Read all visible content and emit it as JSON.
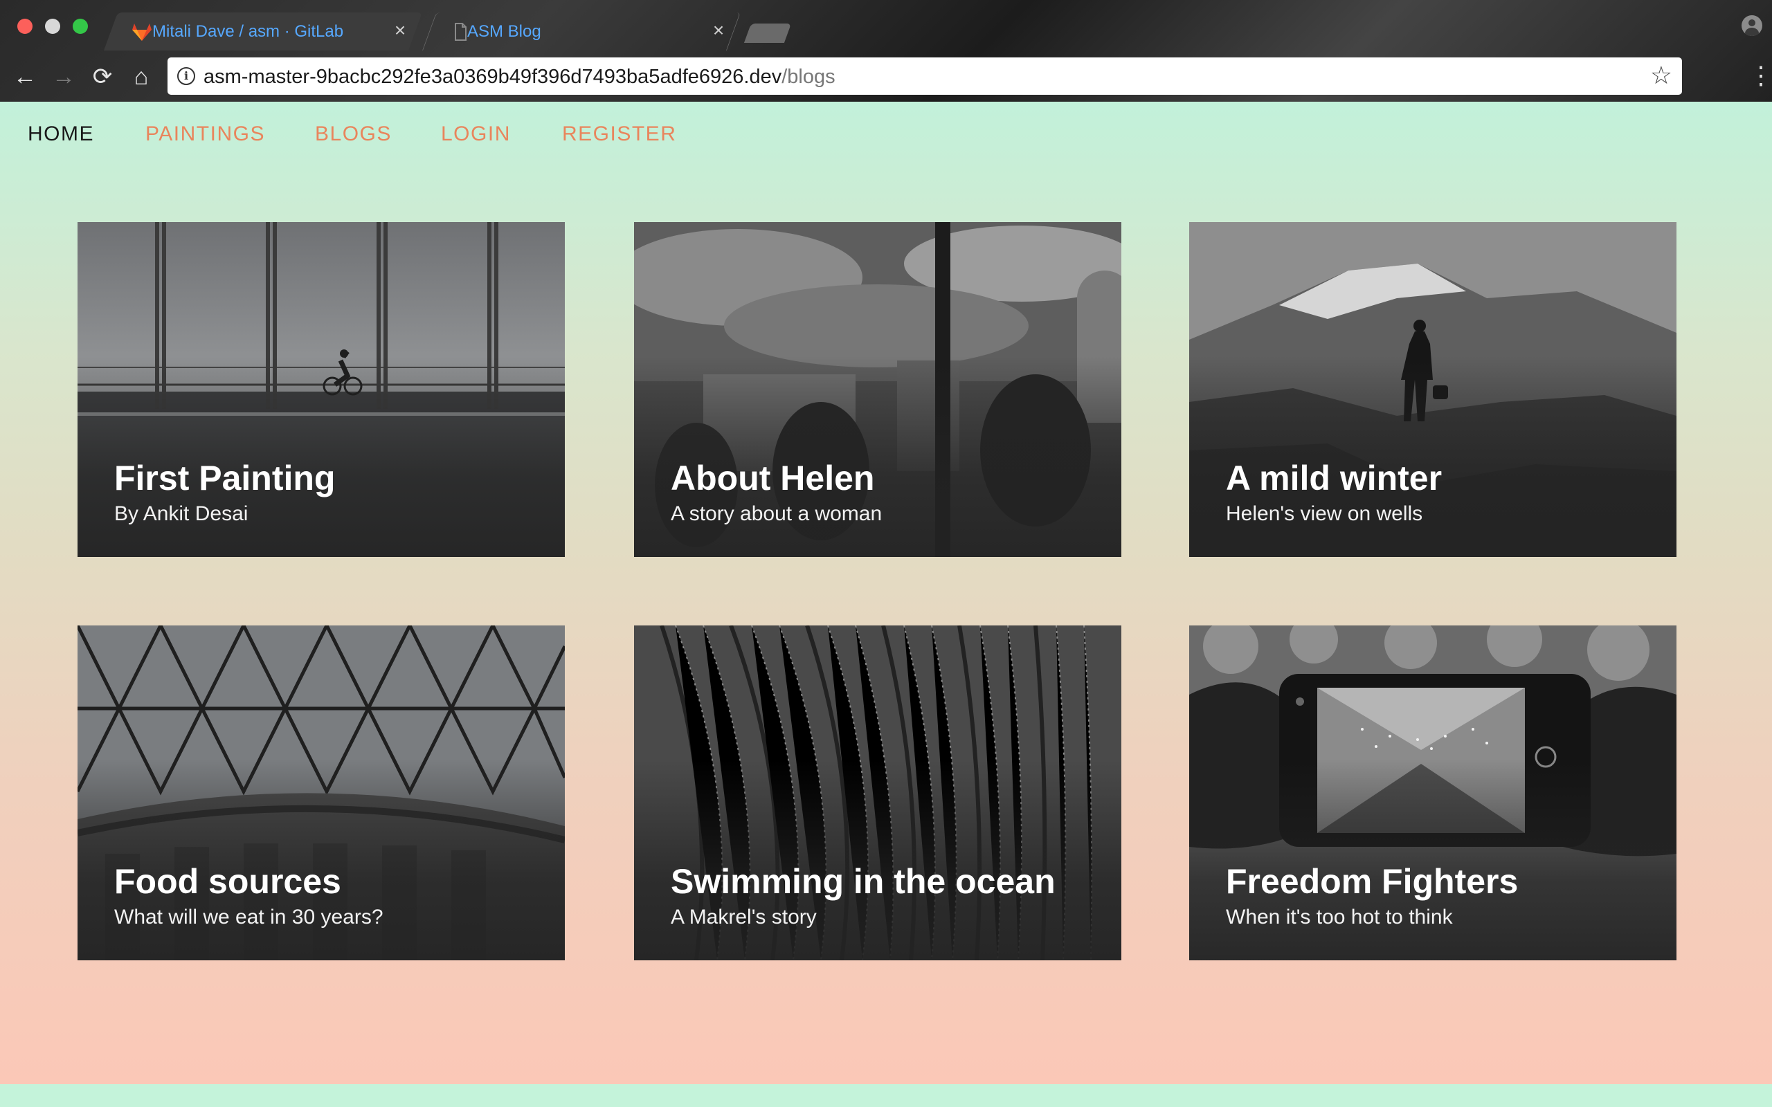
{
  "browser": {
    "tabs": [
      {
        "title": "Mitali Dave / asm · GitLab",
        "icon": "gitlab-icon",
        "active": true
      },
      {
        "title": "ASM Blog",
        "icon": "document-icon",
        "active": false
      }
    ],
    "close_glyph": "×",
    "url_host": "asm-master-9bacbc292fe3a0369b49f396d7493ba5adfe6926.dev",
    "url_path": "/blogs",
    "toolbar": {
      "back_glyph": "←",
      "forward_glyph": "→",
      "reload_glyph": "⟳",
      "home_glyph": "⌂",
      "info_glyph": "i",
      "star_glyph": "☆",
      "menu_glyph": "⋮"
    }
  },
  "nav": {
    "items": [
      {
        "label": "HOME",
        "active": true
      },
      {
        "label": "PAINTINGS",
        "active": false
      },
      {
        "label": "BLOGS",
        "active": false
      },
      {
        "label": "LOGIN",
        "active": false
      },
      {
        "label": "REGISTER",
        "active": false
      }
    ]
  },
  "colors": {
    "nav_accent": "#e9855c",
    "nav_active": "#1a1a1a",
    "gradient_top": "#c2f1da",
    "gradient_bottom": "#fbc8b7"
  },
  "cards": [
    {
      "title": "First Painting",
      "subtitle": "By Ankit Desai",
      "image": "bridge-cyclist-image"
    },
    {
      "title": "About Helen",
      "subtitle": "A story about a woman",
      "image": "city-clouds-silhouettes-image"
    },
    {
      "title": "A mild winter",
      "subtitle": "Helen's view on wells",
      "image": "mountain-hiker-image"
    },
    {
      "title": "Food sources",
      "subtitle": "What will we eat in 30 years?",
      "image": "glass-dome-roof-image"
    },
    {
      "title": "Swimming in the ocean",
      "subtitle": "A Makrel's story",
      "image": "library-bookshelves-image"
    },
    {
      "title": "Freedom Fighters",
      "subtitle": "When it's too hot to think",
      "image": "phone-photo-lights-image"
    }
  ]
}
